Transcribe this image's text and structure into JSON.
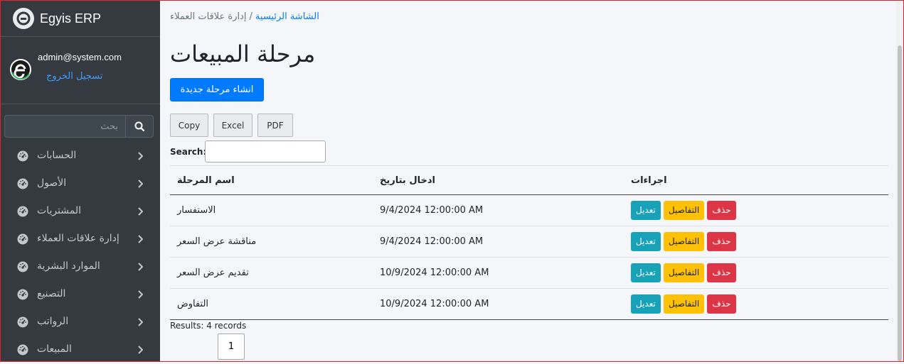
{
  "app": {
    "title": "Egyis ERP"
  },
  "user": {
    "email": "admin@system.com",
    "logout_label": "تسجيل الخروج"
  },
  "sidebar": {
    "search_placeholder": "بحث",
    "items": [
      {
        "label": "الحسابات",
        "icon": "dashboard-icon"
      },
      {
        "label": "الأصول",
        "icon": "dashboard-icon"
      },
      {
        "label": "المشتريات",
        "icon": "dashboard-icon"
      },
      {
        "label": "إدارة علاقات العملاء",
        "icon": "dashboard-icon"
      },
      {
        "label": "الموارد البشرية",
        "icon": "dashboard-icon"
      },
      {
        "label": "التصنيع",
        "icon": "dashboard-icon"
      },
      {
        "label": "الرواتب",
        "icon": "dashboard-icon"
      },
      {
        "label": "المبيعات",
        "icon": "dashboard-icon"
      }
    ]
  },
  "breadcrumb": {
    "home": "الشاشة الرئيسية",
    "separator": "/",
    "current": "إدارة علاقات العملاء"
  },
  "page": {
    "title": "مرحلة المبيعات",
    "create_label": "انشاء مرحلة جديدة"
  },
  "export": {
    "copy": "Copy",
    "excel": "Excel",
    "pdf": "PDF"
  },
  "search": {
    "label": "Search:",
    "value": ""
  },
  "table": {
    "headers": [
      "اسم المرحلة",
      "ادخال بتاريخ",
      "اجراءات"
    ],
    "actions": {
      "edit": "تعديل",
      "details": "التفاصيل",
      "delete": "حذف"
    },
    "rows": [
      {
        "name": "الاستفسار",
        "date": "9/4/2024 12:00:00 AM"
      },
      {
        "name": "مناقشة عرض السعر",
        "date": "9/4/2024 12:00:00 AM"
      },
      {
        "name": "تقديم عرض السعر",
        "date": "10/9/2024 12:00:00 AM"
      },
      {
        "name": "التفاوض",
        "date": "10/9/2024 12:00:00 AM"
      }
    ]
  },
  "footer": {
    "results": "Results: 4 records",
    "page": "1"
  },
  "colors": {
    "sidebar": "#343a40",
    "primary": "#007bff",
    "info": "#17a2b8",
    "warning": "#ffc107",
    "danger": "#dc3545"
  }
}
